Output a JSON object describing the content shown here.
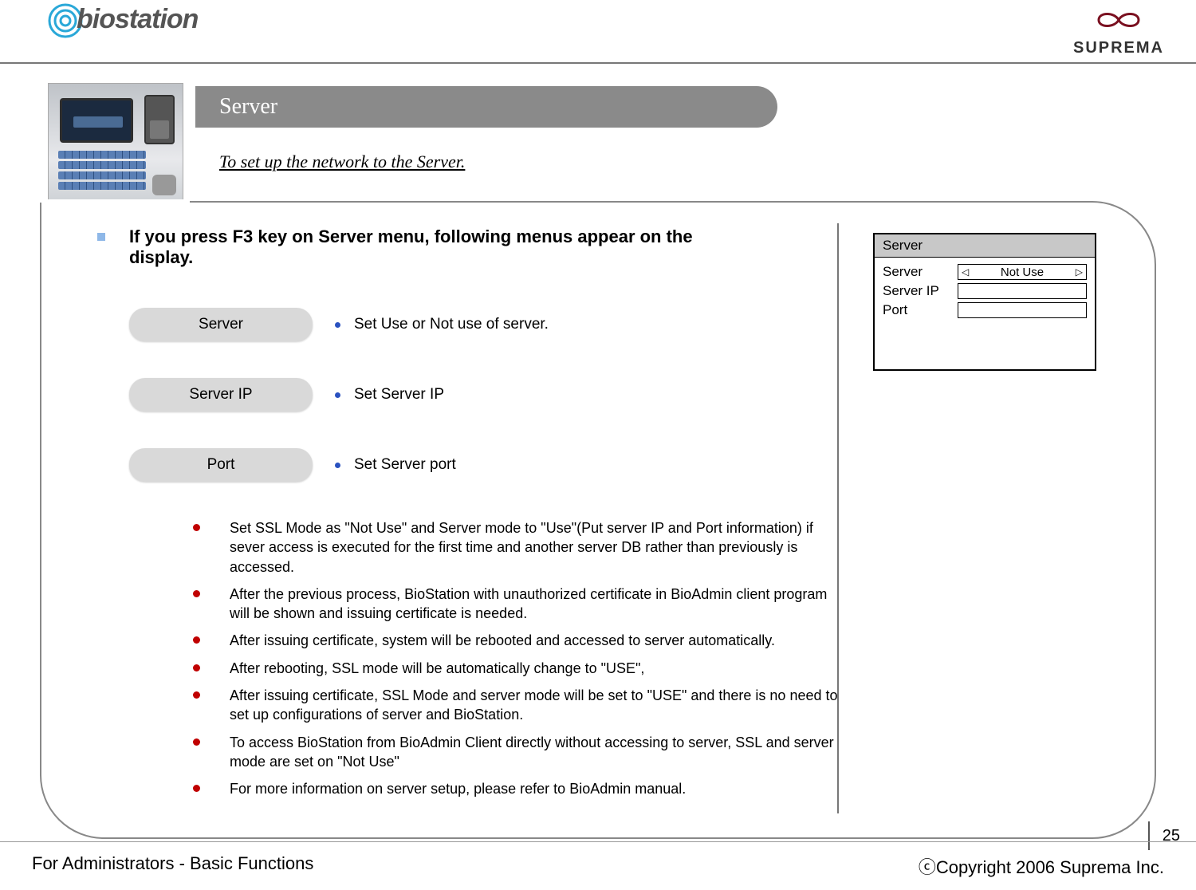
{
  "brand_left": "biostation",
  "brand_right": "SUPREMA",
  "title": "Server",
  "subtitle": "To set up the network to the Server.",
  "intro": "If you press F3 key on Server menu, following menus appear on the display.",
  "items": [
    {
      "label": "Server",
      "desc": "Set Use or Not use of server."
    },
    {
      "label": "Server IP",
      "desc": "Set Server IP"
    },
    {
      "label": "Port",
      "desc": "Set Server port"
    }
  ],
  "notes": [
    "Set SSL   Mode as  \"Not Use\" and  Server mode to \"Use\"(Put server IP and Port information) if sever access is executed for the first time and another server DB rather than previously is accessed.",
    "After the previous process, BioStation with unauthorized certificate in BioAdmin client program will be shown and issuing certificate is needed.",
    "After issuing certificate, system will be rebooted and accessed to server automatically.",
    "After rebooting, SSL mode will be automatically change to \"USE\",",
    "After issuing certificate, SSL Mode and server mode will be set to \"USE\" and  there is no need to set up configurations of server and BioStation.",
    "To access BioStation from BioAdmin Client directly without accessing to server, SSL and server mode are set on \"Not Use\"",
    "For more information on server setup, please refer to BioAdmin manual."
  ],
  "screen": {
    "title": "Server",
    "rows": [
      {
        "label": "Server",
        "value": "Not Use",
        "arrows": true
      },
      {
        "label": "Server IP",
        "value": "",
        "arrows": false
      },
      {
        "label": "Port",
        "value": "",
        "arrows": false
      }
    ]
  },
  "page_number": "25",
  "footer_left": "For Administrators - Basic Functions",
  "footer_right": "ⓒCopyright 2006 Suprema Inc."
}
